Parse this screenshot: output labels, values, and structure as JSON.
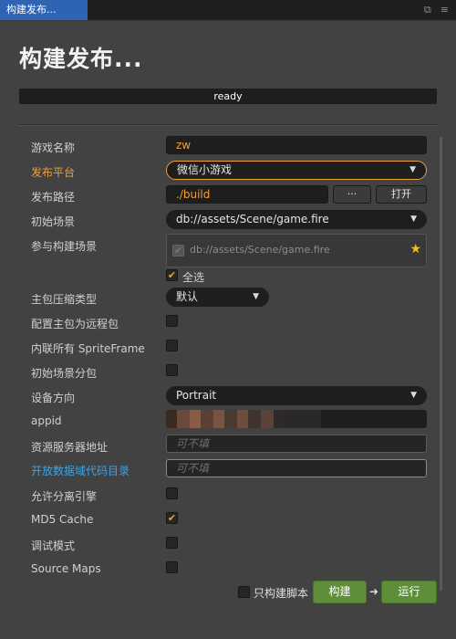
{
  "tab": {
    "title": "构建发布..."
  },
  "header": {
    "title": "构建发布...",
    "status": "ready"
  },
  "form": {
    "game_name_label": "游戏名称",
    "game_name_value": "zw",
    "platform_label": "发布平台",
    "platform_value": "微信小游戏",
    "path_label": "发布路径",
    "path_value": "./build",
    "path_browse": "···",
    "path_open": "打开",
    "start_scene_label": "初始场景",
    "start_scene_value": "db://assets/Scene/game.fire",
    "scenes_label": "参与构建场景",
    "scenes": [
      "db://assets/Scene/game.fire"
    ],
    "select_all_label": "全选",
    "compression_label": "主包压缩类型",
    "compression_value": "默认",
    "remote_main_label": "配置主包为远程包",
    "inline_sprite_label": "内联所有 SpriteFrame",
    "start_scene_subpack_label": "初始场景分包",
    "orientation_label": "设备方向",
    "orientation_value": "Portrait",
    "appid_label": "appid",
    "server_label": "资源服务器地址",
    "server_placeholder": "可不填",
    "open_data_label": "开放数据域代码目录",
    "open_data_placeholder": "可不填",
    "separate_engine_label": "允许分离引擎",
    "md5_label": "MD5 Cache",
    "debug_label": "调试模式",
    "source_maps_label": "Source Maps"
  },
  "checkboxes": {
    "select_all": true,
    "remote_main": false,
    "inline_sprite": false,
    "start_scene_subpack": false,
    "separate_engine": false,
    "md5": true,
    "debug": false,
    "source_maps": false,
    "build_script_only": false
  },
  "footer": {
    "build_script_only_label": "只构建脚本",
    "build_label": "构建",
    "run_label": "运行"
  },
  "colors": {
    "accent_orange": "#ef9f3c",
    "link_blue": "#3fa2e6",
    "build_green": "#5f8e3a",
    "tab_blue": "#2f63b4"
  }
}
